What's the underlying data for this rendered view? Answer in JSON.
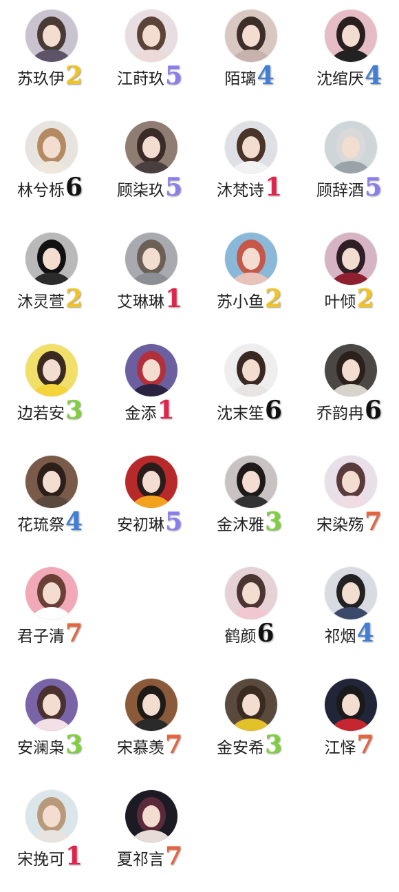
{
  "contacts": [
    {
      "name": "苏玖伊",
      "number": "2",
      "number_color": "#f2c41f",
      "avatar_bg": "#c9c3cf",
      "avatar_hair": "#4a3a34",
      "avatar_cloth": "#5d5468"
    },
    {
      "name": "江莳玖",
      "number": "5",
      "number_color": "#8a7df0",
      "avatar_bg": "#e8dde0",
      "avatar_hair": "#5a4438",
      "avatar_cloth": "#ecdad8"
    },
    {
      "name": "陌璃",
      "number": "4",
      "number_color": "#3f7fd8",
      "avatar_bg": "#d9c7c2",
      "avatar_hair": "#3e2e2a",
      "avatar_cloth": "#c7b2ad"
    },
    {
      "name": "沈绾厌",
      "number": "4",
      "number_color": "#3f7fd8",
      "avatar_bg": "#e6bcc6",
      "avatar_hair": "#2a1f1f",
      "avatar_cloth": "#222222"
    },
    {
      "name": "林兮栎",
      "number": "6",
      "number_color": "#111111",
      "avatar_bg": "#e7e3df",
      "avatar_hair": "#b48a62",
      "avatar_cloth": "#efe6dc"
    },
    {
      "name": "顾柒玖",
      "number": "5",
      "number_color": "#8a7df0",
      "avatar_bg": "#8f7c72",
      "avatar_hair": "#3a2b26",
      "avatar_cloth": "#4a3f3f"
    },
    {
      "name": "沐梵诗",
      "number": "1",
      "number_color": "#e0244d",
      "avatar_bg": "#dfe0e4",
      "avatar_hair": "#4a3328",
      "avatar_cloth": "#f2f2f2"
    },
    {
      "name": "顾辞酒",
      "number": "5",
      "number_color": "#8a7df0",
      "avatar_bg": "#cfd6da",
      "avatar_hair": "#d9d9d9",
      "avatar_cloth": "#9aa3aa"
    },
    {
      "name": "沐灵萱",
      "number": "2",
      "number_color": "#f2c41f",
      "avatar_bg": "#b9b9b9",
      "avatar_hair": "#111111",
      "avatar_cloth": "#2b2b2b"
    },
    {
      "name": "艾琳琳",
      "number": "1",
      "number_color": "#e0244d",
      "avatar_bg": "#a9aab0",
      "avatar_hair": "#6a6055",
      "avatar_cloth": "#8d8f94"
    },
    {
      "name": "苏小鱼",
      "number": "2",
      "number_color": "#f2c41f",
      "avatar_bg": "#8ab8d8",
      "avatar_hair": "#c6584a",
      "avatar_cloth": "#e8c3b9"
    },
    {
      "name": "叶倾",
      "number": "2",
      "number_color": "#f2c41f",
      "avatar_bg": "#d7b4c4",
      "avatar_hair": "#2d1f25",
      "avatar_cloth": "#8e1f2e"
    },
    {
      "name": "边若安",
      "number": "3",
      "number_color": "#7fd13a",
      "avatar_bg": "#f0e06a",
      "avatar_hair": "#3a2a20",
      "avatar_cloth": "#f5d33a"
    },
    {
      "name": "金添",
      "number": "1",
      "number_color": "#e0244d",
      "avatar_bg": "#6b5fa0",
      "avatar_hair": "#b2303b",
      "avatar_cloth": "#2a2240"
    },
    {
      "name": "沈末笙",
      "number": "6",
      "number_color": "#111111",
      "avatar_bg": "#eeeeee",
      "avatar_hair": "#3a2822",
      "avatar_cloth": "#e9e4e4"
    },
    {
      "name": "乔韵冉",
      "number": "6",
      "number_color": "#111111",
      "avatar_bg": "#4b4744",
      "avatar_hair": "#2a211d",
      "avatar_cloth": "#d8d4cc"
    },
    {
      "name": "花琉祭",
      "number": "4",
      "number_color": "#3f7fd8",
      "avatar_bg": "#7a5b49",
      "avatar_hair": "#2c1e18",
      "avatar_cloth": "#5a4a3e"
    },
    {
      "name": "安初琳",
      "number": "5",
      "number_color": "#8a7df0",
      "avatar_bg": "#b8292a",
      "avatar_hair": "#2a1c1a",
      "avatar_cloth": "#f2a21d"
    },
    {
      "name": "金沐雅",
      "number": "3",
      "number_color": "#7fd13a",
      "avatar_bg": "#c9c2c2",
      "avatar_hair": "#1f1a1a",
      "avatar_cloth": "#333333"
    },
    {
      "name": "宋染殇",
      "number": "7",
      "number_color": "#e8643c",
      "avatar_bg": "#e9dfe8",
      "avatar_hair": "#5a3b3b",
      "avatar_cloth": "#f0dce3"
    },
    {
      "name": "君子清",
      "number": "7",
      "number_color": "#e8643c",
      "avatar_bg": "#f2a9b7",
      "avatar_hair": "#6a3f36",
      "avatar_cloth": "#ffffff"
    },
    null,
    {
      "name": "鹤颜",
      "number": "6",
      "number_color": "#111111",
      "avatar_bg": "#e6d2d6",
      "avatar_hair": "#4a3533",
      "avatar_cloth": "#f1c8d2"
    },
    {
      "name": "祁烟",
      "number": "4",
      "number_color": "#3f7fd8",
      "avatar_bg": "#d8dbe2",
      "avatar_hair": "#222222",
      "avatar_cloth": "#3b4a6a"
    },
    {
      "name": "安澜枭",
      "number": "3",
      "number_color": "#7fd13a",
      "avatar_bg": "#7a64a8",
      "avatar_hair": "#4a3130",
      "avatar_cloth": "#f2e0e6"
    },
    {
      "name": "宋慕羡",
      "number": "7",
      "number_color": "#e8643c",
      "avatar_bg": "#8a5a3a",
      "avatar_hair": "#1e1a18",
      "avatar_cloth": "#2a2a2a"
    },
    {
      "name": "金安希",
      "number": "3",
      "number_color": "#7fd13a",
      "avatar_bg": "#5a4a3e",
      "avatar_hair": "#3a2a20",
      "avatar_cloth": "#e2c12a"
    },
    {
      "name": "江怿",
      "number": "7",
      "number_color": "#e8643c",
      "avatar_bg": "#202538",
      "avatar_hair": "#1a1a1a",
      "avatar_cloth": "#c62631"
    },
    {
      "name": "宋挽可",
      "number": "1",
      "number_color": "#e0244d",
      "avatar_bg": "#dbe6ea",
      "avatar_hair": "#b89a7a",
      "avatar_cloth": "#e8e2e0"
    },
    {
      "name": "夏祁言",
      "number": "7",
      "number_color": "#e8643c",
      "avatar_bg": "#1c1a22",
      "avatar_hair": "#5a2a3a",
      "avatar_cloth": "#e8dcd8"
    }
  ]
}
